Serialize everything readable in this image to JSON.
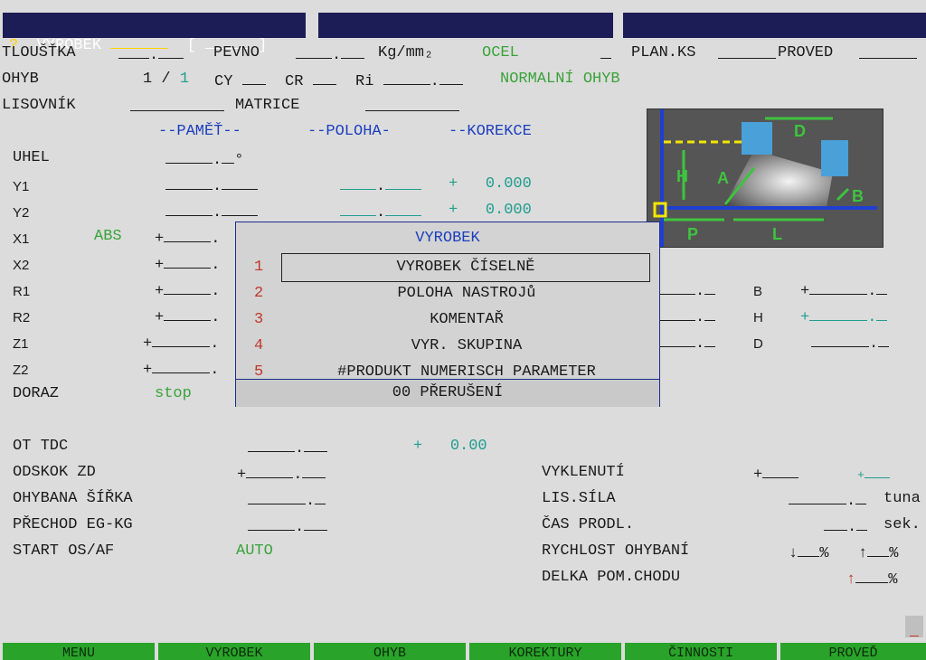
{
  "header": {
    "q": "?",
    "title": "VYROBEK",
    "bracket_open": "[",
    "bracket_close": "]"
  },
  "row1": {
    "thickness_label": "TLOUŠŤKA",
    "strength_label": "PEVNO",
    "unit": "Kg/mm",
    "material": "OCEL",
    "plan_label": "PLAN.KS",
    "proved_label": "PROVED"
  },
  "row2": {
    "bend_label": "OHYB",
    "bend_current": "1",
    "bend_sep": "/",
    "bend_total": "1",
    "cy_label": "CY",
    "cr_label": "CR",
    "ri_label": "Ri",
    "bend_type": "NORMALNÍ OHYB"
  },
  "row3": {
    "punch_label": "LISOVNÍK",
    "die_label": "MATRICE"
  },
  "columns": {
    "memory": "--PAMĚŤ--",
    "position": "--POLOHA-",
    "correction": "--KOREKCE"
  },
  "params": {
    "uhel": "UHEL",
    "degree": "°",
    "y1": "Y1",
    "y2": "Y2",
    "x1": "X1",
    "x2": "X2",
    "r1": "R1",
    "r2": "R2",
    "z1": "Z1",
    "z2": "Z2",
    "abs": "ABS",
    "doraz": "DORAZ",
    "doraz_value": "stop",
    "plus": "+",
    "y1_corr": "0.000",
    "y2_corr": "0.000"
  },
  "right_params": {
    "b": "B",
    "h": "H",
    "d": "D"
  },
  "diagram": {
    "labels": [
      "D",
      "H",
      "A",
      "B",
      "P",
      "L"
    ],
    "colors": {
      "frame": "#1f3fd0",
      "arrow": "#3ec43e",
      "dash": "#f5e600",
      "tool": "#4aa0d8"
    }
  },
  "popup": {
    "title": "VYROBEK",
    "items": [
      {
        "num": "1",
        "label": "VYROBEK ČÍSELNĚ"
      },
      {
        "num": "2",
        "label": "POLOHA NASTROJů"
      },
      {
        "num": "3",
        "label": "KOMENTAŘ"
      },
      {
        "num": "4",
        "label": "VYR. SKUPINA"
      },
      {
        "num": "5",
        "label": "#PRODUKT NUMERISCH PARAMETER"
      }
    ],
    "cancel": "00 PŘERUŠENÍ"
  },
  "lower": {
    "ot_tdc": "OT TDC",
    "ot_tdc_corr": "0.00",
    "odskok": "ODSKOK ZD",
    "ohybana": "OHYBANA ŠÍŘKA",
    "prechod": "PŘECHOD EG-KG",
    "start": "START OS/AF",
    "start_value": "AUTO",
    "vyklenuti": "VYKLENUTÍ",
    "lis_sila": "LIS.SÍLA",
    "lis_sila_unit": "tuna",
    "cas": "ČAS PRODL.",
    "cas_unit": "sek.",
    "rychlost": "RYCHLOST OHYBANÍ",
    "delka": "DELKA POM.CHODU",
    "down": "↓",
    "up": "↑",
    "pct": "%"
  },
  "softkeys": [
    "MENU",
    "VYROBEK",
    "OHYB",
    "KOREKTURY",
    "ČINNOSTI",
    "PROVEĎ"
  ]
}
